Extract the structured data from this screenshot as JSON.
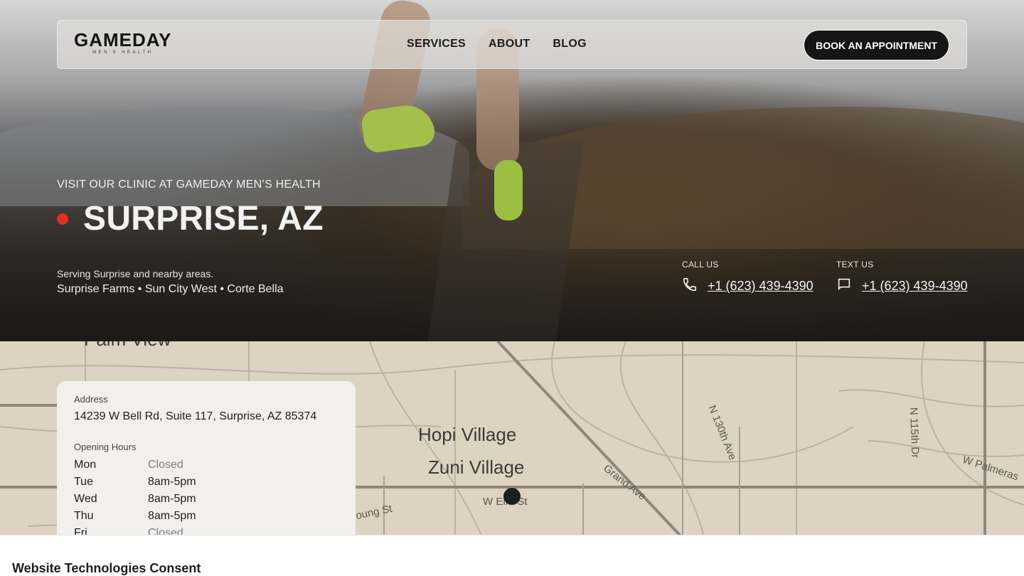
{
  "nav": {
    "logo": "GAMEDAY",
    "logo_sub": "MEN'S HEALTH",
    "links": [
      "SERVICES",
      "ABOUT",
      "BLOG"
    ],
    "cta": "BOOK AN APPOINTMENT"
  },
  "hero": {
    "eyebrow": "VISIT OUR CLINIC AT GAMEDAY MEN’S HEALTH",
    "title": "SURPRISE, AZ",
    "serving": "Serving Surprise and nearby areas.",
    "areas": "Surprise Farms • Sun City West • Corte Bella",
    "call_label": "CALL US",
    "call_number": "+1 (623) 439-4390",
    "text_label": "TEXT US",
    "text_number": "+1 (623) 439-4390",
    "accent_color": "#e03026"
  },
  "map": {
    "labels": [
      "Palm View",
      "Hopi Village",
      "Zuni Village",
      "Grand Ave",
      "W Elm St",
      "oung St",
      "N 130th Ave",
      "N 115th Dr",
      "W Palmeras"
    ]
  },
  "card": {
    "address_label": "Address",
    "address": "14239 W Bell Rd, Suite 117, Surprise, AZ 85374",
    "hours_label": "Opening Hours",
    "hours": [
      {
        "day": "Mon",
        "value": "Closed"
      },
      {
        "day": "Tue",
        "value": "8am-5pm"
      },
      {
        "day": "Wed",
        "value": "8am-5pm"
      },
      {
        "day": "Thu",
        "value": "8am-5pm"
      },
      {
        "day": "Fri",
        "value": "Closed"
      }
    ]
  },
  "consent": {
    "title": "Website Technologies Consent"
  }
}
